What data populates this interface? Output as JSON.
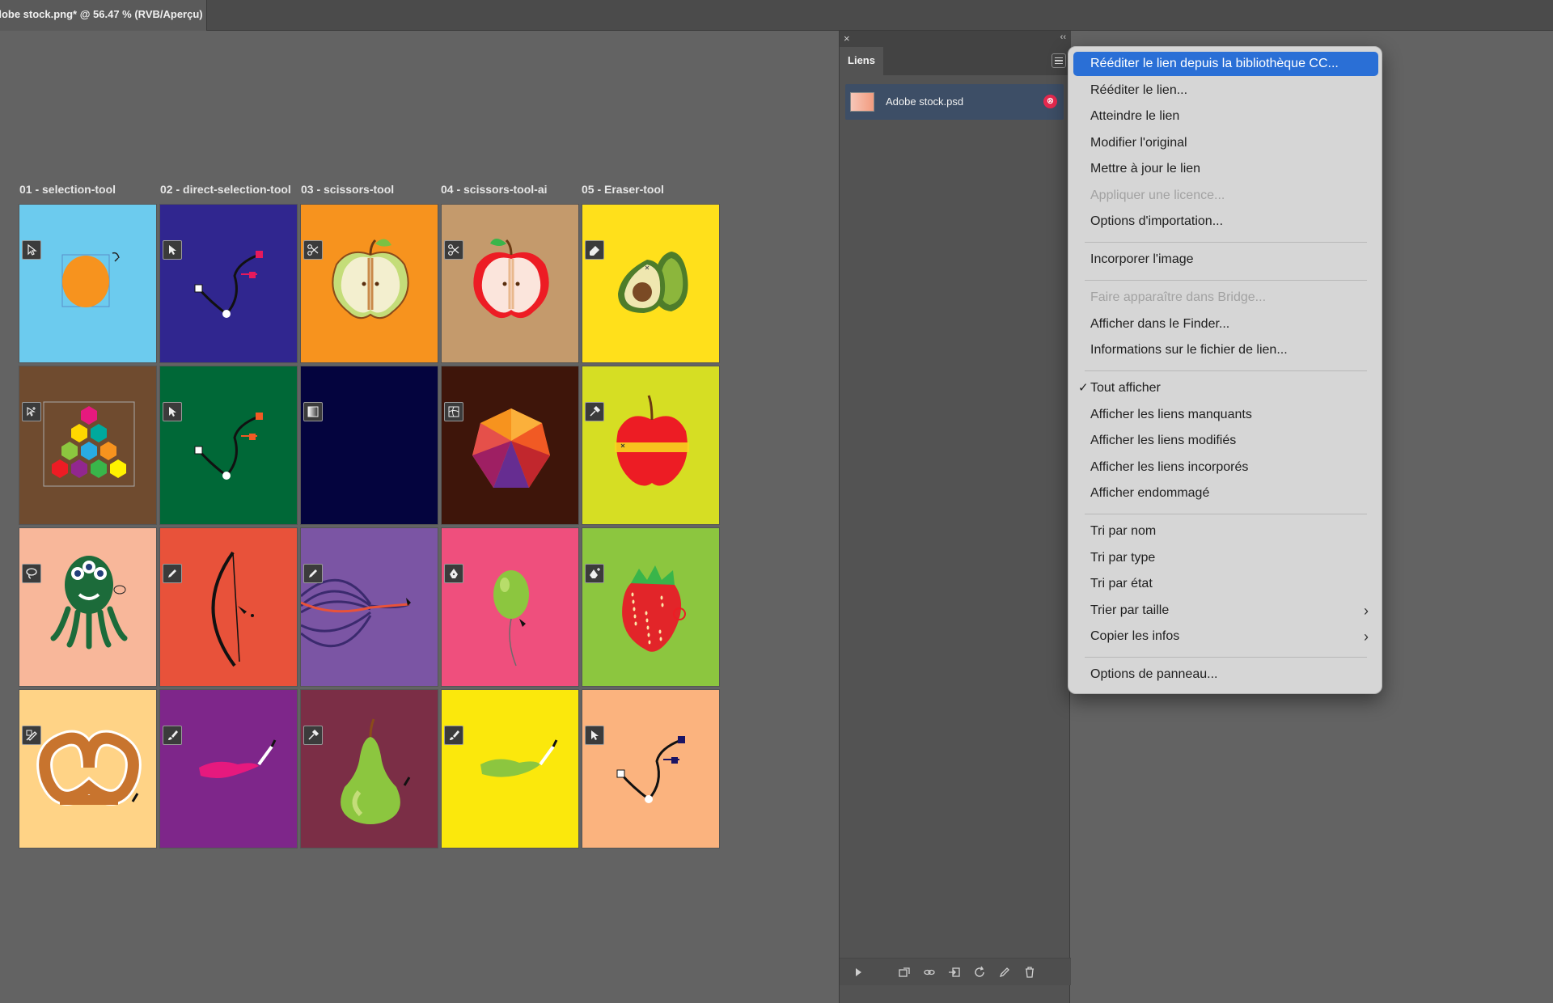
{
  "document_tab": {
    "title": "dobe stock.png* @ 56.47 % (RVB/Aperçu)"
  },
  "canvas": {
    "column_labels": [
      "01 - selection-tool",
      "02 - direct-selection-tool",
      "03 - scissors-tool",
      "04 - scissors-tool-ai",
      "05 - Eraser-tool"
    ],
    "tiles": [
      {
        "bg": "#6ccbee",
        "icon": "arrow-outline-icon",
        "art": "orange-circle"
      },
      {
        "bg": "#30268f",
        "icon": "arrow-filled-icon",
        "art": "path-red"
      },
      {
        "bg": "#f7931e",
        "icon": "scissors-icon",
        "art": "apple-half-green"
      },
      {
        "bg": "#c49a6c",
        "icon": "scissors-icon",
        "art": "apple-half-red"
      },
      {
        "bg": "#ffe01b",
        "icon": "eraser-icon",
        "art": "avocado"
      },
      {
        "bg": "#6f4b2f",
        "icon": "group-select-icon",
        "art": "hexagons"
      },
      {
        "bg": "#006837",
        "icon": "arrow-filled-icon",
        "art": "path-orange"
      },
      {
        "bg": "#04043e",
        "icon": "gradient-icon",
        "art": "empty"
      },
      {
        "bg": "#3e150a",
        "icon": "mesh-icon",
        "art": "polygon-gem"
      },
      {
        "bg": "#d6de23",
        "icon": "eyedropper-icon",
        "art": "red-apple"
      },
      {
        "bg": "#f8b79a",
        "icon": "lasso-icon",
        "art": "octopus"
      },
      {
        "bg": "#e8523a",
        "icon": "pencil-icon",
        "art": "bow"
      },
      {
        "bg": "#7b55a4",
        "icon": "pencil-icon",
        "art": "curves"
      },
      {
        "bg": "#ef4f7d",
        "icon": "pen-icon",
        "art": "balloon"
      },
      {
        "bg": "#8cc63f",
        "icon": "pen-add-icon",
        "art": "strawberry"
      },
      {
        "bg": "#ffd386",
        "icon": "shaper-icon",
        "art": "pretzel"
      },
      {
        "bg": "#7e268a",
        "icon": "brush-icon",
        "art": "pink-stroke"
      },
      {
        "bg": "#7b2e46",
        "icon": "eyedropper-icon",
        "art": "pear"
      },
      {
        "bg": "#fbe80c",
        "icon": "brush-icon",
        "art": "green-stroke"
      },
      {
        "bg": "#fbb37e",
        "icon": "arrow-filled-icon",
        "art": "path-navy"
      }
    ]
  },
  "links_panel": {
    "close_glyph": "×",
    "collapse_glyph": "‹‹",
    "tab_label": "Liens",
    "link_name": "Adobe stock.psd",
    "badge_glyph": "⊗",
    "footer_icons": [
      "play-icon",
      "relink-cc-icon",
      "chain-icon",
      "place-icon",
      "refresh-icon",
      "edit-original-icon",
      "trash-icon"
    ]
  },
  "context_menu": {
    "items": [
      {
        "label": "Rééditer le lien depuis la bibliothèque CC...",
        "state": "selected"
      },
      {
        "label": "Rééditer le lien...",
        "state": "normal"
      },
      {
        "label": "Atteindre le lien",
        "state": "normal"
      },
      {
        "label": "Modifier l'original",
        "state": "normal"
      },
      {
        "label": "Mettre à jour le lien",
        "state": "normal"
      },
      {
        "label": "Appliquer une licence...",
        "state": "disabled"
      },
      {
        "label": "Options d'importation...",
        "state": "normal"
      },
      {
        "label": "Incorporer l'image",
        "state": "normal"
      },
      {
        "label": "Faire apparaître dans Bridge...",
        "state": "disabled"
      },
      {
        "label": "Afficher dans le Finder...",
        "state": "normal"
      },
      {
        "label": "Informations sur le fichier de lien...",
        "state": "normal"
      },
      {
        "label": "Tout afficher",
        "state": "checked",
        "check": "✓"
      },
      {
        "label": "Afficher les liens manquants",
        "state": "normal"
      },
      {
        "label": "Afficher les liens modifiés",
        "state": "normal"
      },
      {
        "label": "Afficher les liens incorporés",
        "state": "normal"
      },
      {
        "label": "Afficher endommagé",
        "state": "normal"
      },
      {
        "label": "Tri par nom",
        "state": "normal"
      },
      {
        "label": "Tri par type",
        "state": "normal"
      },
      {
        "label": "Tri par état",
        "state": "normal"
      },
      {
        "label": "Trier par taille",
        "state": "submenu",
        "arrow": "›"
      },
      {
        "label": "Copier les infos",
        "state": "submenu",
        "arrow": "›"
      },
      {
        "label": "Options de panneau...",
        "state": "normal"
      }
    ],
    "colors": {
      "selected_bg": "#2a6fd6",
      "menu_bg": "#d6d6d6",
      "disabled_text": "#a2a2a2"
    }
  }
}
